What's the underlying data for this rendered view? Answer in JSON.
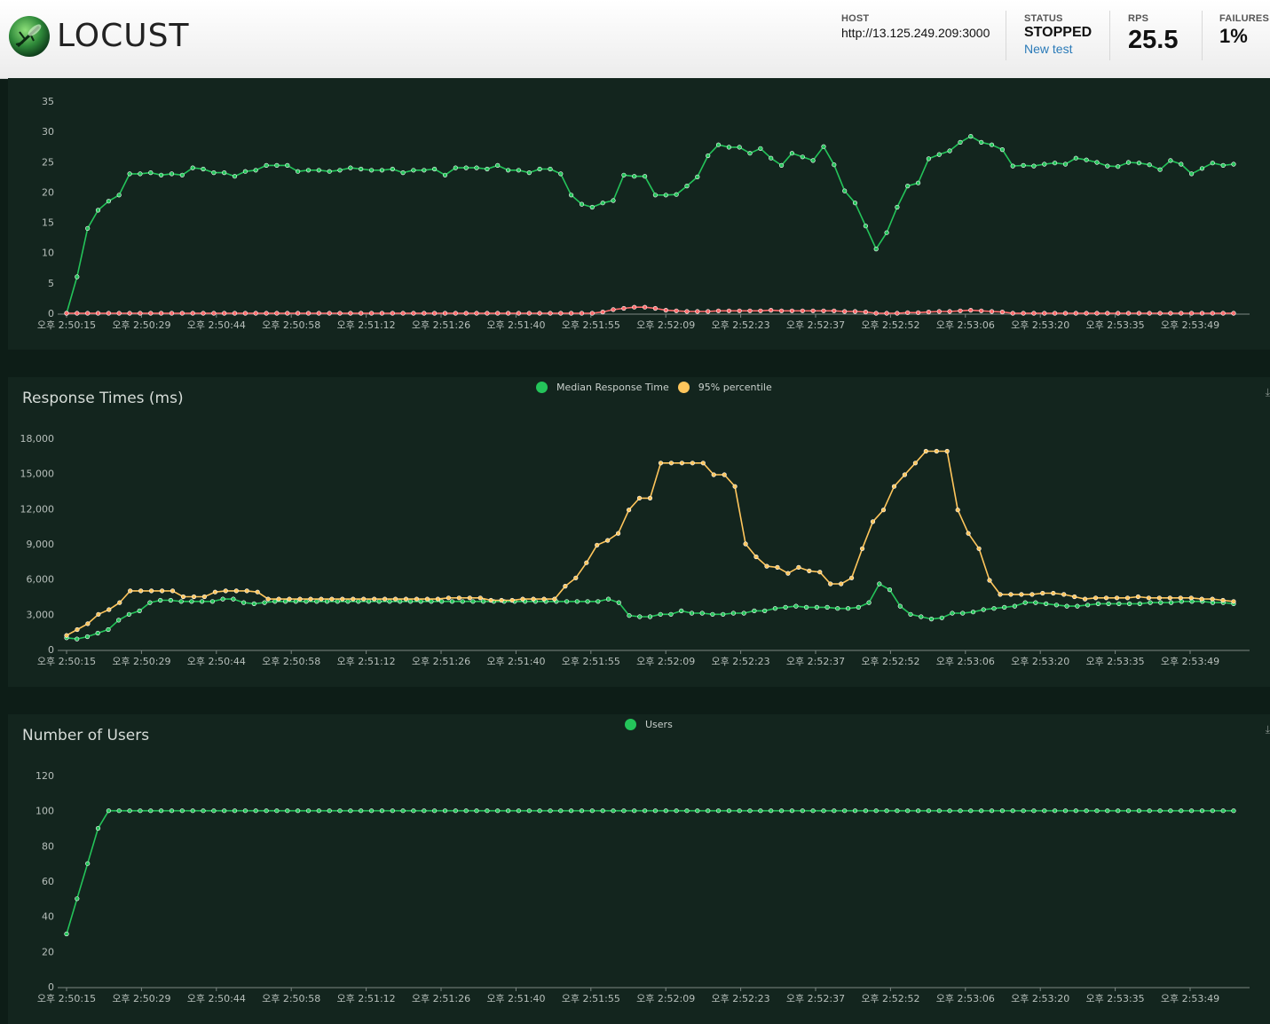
{
  "header": {
    "logo_text": "LOCUST",
    "host_label": "HOST",
    "host_value": "http://13.125.249.209:3000",
    "status_label": "STATUS",
    "status_value": "STOPPED",
    "new_test_label": "New test",
    "rps_label": "RPS",
    "rps_value": "25.5",
    "failures_label": "FAILURES",
    "failures_value": "1%"
  },
  "colors": {
    "rps_line": "#24c45a",
    "failures_line": "#ff6d6d",
    "median_line": "#24c45a",
    "percentile_line": "#ffc65c",
    "users_line": "#24c45a",
    "panel_bg": "#13251e",
    "page_bg": "#0d1d17"
  },
  "x_tick_labels": [
    "오후 2:50:15",
    "오후 2:50:29",
    "오후 2:50:44",
    "오후 2:50:58",
    "오후 2:51:12",
    "오후 2:51:26",
    "오후 2:51:40",
    "오후 2:51:55",
    "오후 2:52:09",
    "오후 2:52:23",
    "오후 2:52:37",
    "오후 2:52:52",
    "오후 2:53:06",
    "오후 2:53:20",
    "오후 2:53:35",
    "오후 2:53:49"
  ],
  "chart_data": [
    {
      "type": "line",
      "title": "",
      "ylim": [
        0,
        35
      ],
      "yticks": [
        0,
        5,
        10,
        15,
        20,
        25,
        30,
        35
      ],
      "grid": false,
      "x_range": [
        "오후 2:50:15",
        "오후 2:54:00"
      ],
      "series": [
        {
          "values": [
            0,
            6,
            14,
            17,
            18.5,
            19.5,
            23,
            23,
            23.2,
            22.8,
            23,
            22.8,
            24,
            23.8,
            23.2,
            23.2,
            22.6,
            23.4,
            23.6,
            24.4,
            24.4,
            24.4,
            23.4,
            23.6,
            23.6,
            23.4,
            23.6,
            24,
            23.8,
            23.6,
            23.6,
            23.8,
            23.2,
            23.6,
            23.6,
            23.8,
            22.8,
            24,
            24,
            24,
            23.8,
            24.4,
            23.6,
            23.6,
            23.2,
            23.8,
            23.8,
            23,
            19.5,
            18,
            17.5,
            18.2,
            18.6,
            22.8,
            22.6,
            22.6,
            19.5,
            19.5,
            19.6,
            21,
            22.5,
            26,
            27.8,
            27.4,
            27.4,
            26.4,
            27.2,
            25.6,
            24.4,
            26.4,
            25.8,
            25.2,
            27.5,
            24.5,
            20.2,
            18.2,
            14.4,
            10.6,
            13.3,
            17.5,
            21,
            21.5,
            25.5,
            26.2,
            26.8,
            28.2,
            29.2,
            28.2,
            27.8,
            27,
            24.3,
            24.4,
            24.3,
            24.6,
            24.8,
            24.6,
            25.6,
            25.3,
            24.9,
            24.3,
            24.2,
            24.9,
            24.8,
            24.5,
            23.7,
            25.2,
            24.6,
            23,
            23.9,
            24.8,
            24.4,
            24.6
          ]
        },
        {
          "values": [
            0,
            0,
            0,
            0,
            0,
            0,
            0,
            0,
            0,
            0,
            0,
            0,
            0,
            0,
            0,
            0,
            0,
            0,
            0,
            0,
            0,
            0,
            0,
            0,
            0,
            0,
            0,
            0,
            0,
            0,
            0,
            0,
            0,
            0,
            0,
            0,
            0,
            0,
            0,
            0,
            0,
            0,
            0,
            0,
            0,
            0,
            0,
            0,
            0,
            0,
            0,
            0.2,
            0.6,
            0.8,
            1,
            1,
            0.8,
            0.5,
            0.4,
            0.3,
            0.3,
            0.3,
            0.4,
            0.4,
            0.4,
            0.4,
            0.4,
            0.5,
            0.4,
            0.4,
            0.4,
            0.4,
            0.4,
            0.4,
            0.3,
            0.3,
            0.2,
            0,
            0,
            0,
            0.1,
            0.1,
            0.2,
            0.3,
            0.3,
            0.4,
            0.5,
            0.4,
            0.3,
            0.2,
            0,
            0,
            0,
            0,
            0,
            0,
            0,
            0,
            0,
            0,
            0,
            0,
            0,
            0,
            0,
            0,
            0,
            0,
            0,
            0,
            0,
            0
          ]
        }
      ]
    },
    {
      "type": "line",
      "title": "Response Times (ms)",
      "ylim": [
        0,
        18000
      ],
      "yticks": [
        "0",
        "3,000",
        "6,000",
        "9,000",
        "12,000",
        "15,000",
        "18,000"
      ],
      "grid": false,
      "legend": "top",
      "series": [
        {
          "name": "Median Response Time",
          "values": [
            1000,
            900,
            1100,
            1400,
            1700,
            2500,
            3000,
            3300,
            4000,
            4200,
            4200,
            4100,
            4100,
            4100,
            4100,
            4300,
            4300,
            4000,
            3900,
            4000,
            4100,
            4100,
            4100,
            4100,
            4100,
            4100,
            4100,
            4100,
            4100,
            4100,
            4100,
            4100,
            4100,
            4100,
            4100,
            4100,
            4100,
            4100,
            4100,
            4100,
            4100,
            4100,
            4100,
            4100,
            4100,
            4100,
            4100,
            4100,
            4100,
            4100,
            4100,
            4100,
            4300,
            4000,
            2900,
            2800,
            2800,
            3000,
            3000,
            3300,
            3100,
            3100,
            3000,
            3000,
            3100,
            3100,
            3300,
            3300,
            3500,
            3600,
            3700,
            3600,
            3600,
            3600,
            3500,
            3500,
            3600,
            4000,
            5600,
            5100,
            3700,
            3000,
            2800,
            2600,
            2700,
            3100,
            3100,
            3200,
            3400,
            3500,
            3600,
            3700,
            4000,
            4000,
            3900,
            3800,
            3700,
            3700,
            3800,
            3900,
            3900,
            3900,
            3900,
            3900,
            4000,
            4000,
            4000,
            4100,
            4100,
            4100,
            4000,
            4000,
            3900
          ]
        },
        {
          "name": "95% percentile",
          "values": [
            1200,
            1700,
            2200,
            3000,
            3400,
            4000,
            5000,
            5000,
            5000,
            5000,
            5000,
            4500,
            4500,
            4500,
            4900,
            5000,
            5000,
            5000,
            4900,
            4300,
            4300,
            4300,
            4300,
            4300,
            4300,
            4300,
            4300,
            4300,
            4300,
            4300,
            4300,
            4300,
            4300,
            4300,
            4300,
            4300,
            4400,
            4400,
            4400,
            4400,
            4200,
            4200,
            4200,
            4300,
            4300,
            4300,
            4300,
            5400,
            6100,
            7400,
            8900,
            9300,
            9900,
            11900,
            12900,
            12900,
            15900,
            15900,
            15900,
            15900,
            15900,
            14900,
            14900,
            13900,
            9000,
            7900,
            7100,
            7000,
            6500,
            7000,
            6700,
            6600,
            5600,
            5600,
            6100,
            8600,
            10900,
            11900,
            13900,
            14900,
            15900,
            16900,
            16900,
            16900,
            11900,
            9900,
            8600,
            5900,
            4700,
            4700,
            4700,
            4700,
            4800,
            4800,
            4700,
            4500,
            4300,
            4400,
            4400,
            4400,
            4400,
            4500,
            4400,
            4400,
            4400,
            4400,
            4400,
            4300,
            4300,
            4200,
            4100
          ]
        }
      ]
    },
    {
      "type": "line",
      "title": "Number of Users",
      "ylim": [
        0,
        120
      ],
      "yticks": [
        0,
        20,
        40,
        60,
        80,
        100,
        120
      ],
      "grid": false,
      "legend": "top",
      "series": [
        {
          "name": "Users",
          "values": [
            30,
            50,
            70,
            90,
            100,
            100,
            100,
            100,
            100,
            100,
            100,
            100,
            100,
            100,
            100,
            100,
            100,
            100,
            100,
            100,
            100,
            100,
            100,
            100,
            100,
            100,
            100,
            100,
            100,
            100,
            100,
            100,
            100,
            100,
            100,
            100,
            100,
            100,
            100,
            100,
            100,
            100,
            100,
            100,
            100,
            100,
            100,
            100,
            100,
            100,
            100,
            100,
            100,
            100,
            100,
            100,
            100,
            100,
            100,
            100,
            100,
            100,
            100,
            100,
            100,
            100,
            100,
            100,
            100,
            100,
            100,
            100,
            100,
            100,
            100,
            100,
            100,
            100,
            100,
            100,
            100,
            100,
            100,
            100,
            100,
            100,
            100,
            100,
            100,
            100,
            100,
            100,
            100,
            100,
            100,
            100,
            100,
            100,
            100,
            100,
            100,
            100,
            100,
            100,
            100,
            100,
            100,
            100,
            100,
            100,
            100,
            100
          ]
        }
      ]
    }
  ]
}
